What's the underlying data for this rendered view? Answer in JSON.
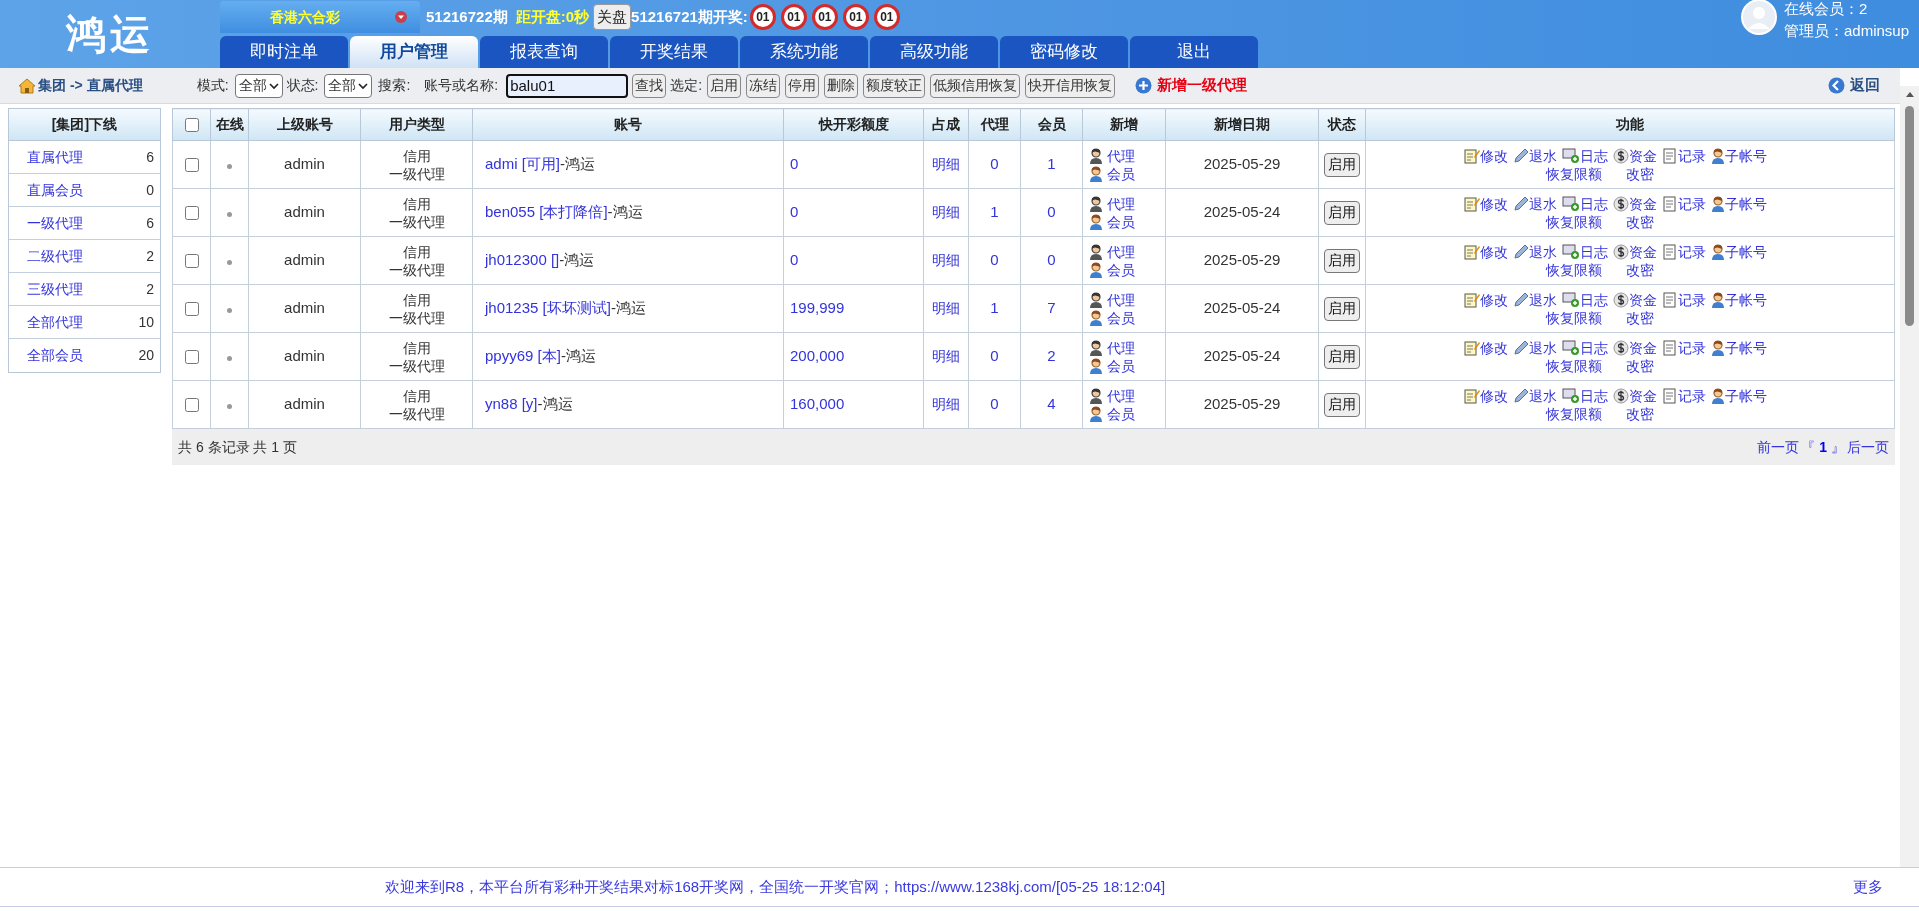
{
  "header": {
    "logo": "鸿运",
    "lottery": "香港六合彩",
    "current_issue": "51216722期",
    "countdown_label": "距开盘:",
    "countdown": "0秒",
    "close_button": "关盘",
    "last_issue": "51216721期开奖:",
    "balls": [
      "01",
      "01",
      "01",
      "01",
      "01"
    ],
    "online": "在线会员：2",
    "admin": "管理员：adminsup"
  },
  "tabs": [
    {
      "label": "即时注单",
      "selected": false
    },
    {
      "label": "用户管理",
      "selected": true
    },
    {
      "label": "报表查询",
      "selected": false
    },
    {
      "label": "开奖结果",
      "selected": false
    },
    {
      "label": "系统功能",
      "selected": false
    },
    {
      "label": "高级功能",
      "selected": false
    },
    {
      "label": "密码修改",
      "selected": false
    },
    {
      "label": "退出",
      "selected": false
    }
  ],
  "toolbar": {
    "breadcrumb": "集团 -> 直属代理",
    "mode_label": "模式:",
    "mode_value": "全部",
    "status_label": "状态:",
    "status_value": "全部",
    "search_label": "搜索:",
    "name_label": "账号或名称:",
    "search_value": "balu01",
    "search_button": "查找",
    "select_label": "选定:",
    "bulk_buttons": [
      "启用",
      "冻结",
      "停用",
      "删除",
      "额度较正",
      "低频信用恢复",
      "快开信用恢复"
    ],
    "add_link": "新增一级代理",
    "back_link": "返回"
  },
  "sidebar": {
    "title": "[集团]下线",
    "items": [
      {
        "label": "直属代理",
        "count": "6"
      },
      {
        "label": "直属会员",
        "count": "0"
      },
      {
        "label": "一级代理",
        "count": "6"
      },
      {
        "label": "二级代理",
        "count": "2"
      },
      {
        "label": "三级代理",
        "count": "2"
      },
      {
        "label": "全部代理",
        "count": "10"
      },
      {
        "label": "全部会员",
        "count": "20"
      }
    ]
  },
  "table": {
    "columns": [
      "在线",
      "上级账号",
      "用户类型",
      "账号",
      "快开彩额度",
      "占成",
      "代理",
      "会员",
      "新增",
      "新增日期",
      "状态",
      "功能"
    ],
    "header_checked": false,
    "rows": [
      {
        "checked": false,
        "online": false,
        "upline": "admin",
        "type": [
          "信用",
          "一级代理"
        ],
        "account": "admi [可用]",
        "suffix": "-鸿运",
        "credit": "0",
        "share": "明细",
        "agents": "0",
        "members": "1",
        "add": [
          "代理",
          "会员"
        ],
        "date": "2025-05-29",
        "status_button": "启用",
        "actions": [
          {
            "kind": "edit",
            "label": "修改"
          },
          {
            "kind": "rebate",
            "label": "退水"
          },
          {
            "kind": "log",
            "label": "日志"
          },
          {
            "kind": "money",
            "label": "资金"
          },
          {
            "kind": "record",
            "label": "记录"
          },
          {
            "kind": "sub",
            "label": "子帐号"
          }
        ],
        "extra_links": [
          "恢复限额",
          "改密"
        ]
      },
      {
        "checked": false,
        "online": false,
        "upline": "admin",
        "type": [
          "信用",
          "一级代理"
        ],
        "account": "ben055 [本打降倍]",
        "suffix": "-鸿运",
        "credit": "0",
        "share": "明细",
        "agents": "1",
        "members": "0",
        "add": [
          "代理",
          "会员"
        ],
        "date": "2025-05-24",
        "status_button": "启用",
        "actions": [
          {
            "kind": "edit",
            "label": "修改"
          },
          {
            "kind": "rebate",
            "label": "退水"
          },
          {
            "kind": "log",
            "label": "日志"
          },
          {
            "kind": "money",
            "label": "资金"
          },
          {
            "kind": "record",
            "label": "记录"
          },
          {
            "kind": "sub",
            "label": "子帐号"
          }
        ],
        "extra_links": [
          "恢复限额",
          "改密"
        ]
      },
      {
        "checked": false,
        "online": false,
        "upline": "admin",
        "type": [
          "信用",
          "一级代理"
        ],
        "account": "jh012300 []",
        "suffix": "-鸿运",
        "credit": "0",
        "share": "明细",
        "agents": "0",
        "members": "0",
        "add": [
          "代理",
          "会员"
        ],
        "date": "2025-05-29",
        "status_button": "启用",
        "actions": [
          {
            "kind": "edit",
            "label": "修改"
          },
          {
            "kind": "rebate",
            "label": "退水"
          },
          {
            "kind": "log",
            "label": "日志"
          },
          {
            "kind": "money",
            "label": "资金"
          },
          {
            "kind": "record",
            "label": "记录"
          },
          {
            "kind": "sub",
            "label": "子帐号"
          }
        ],
        "extra_links": [
          "恢复限额",
          "改密"
        ]
      },
      {
        "checked": false,
        "online": false,
        "upline": "admin",
        "type": [
          "信用",
          "一级代理"
        ],
        "account": "jh01235 [坏坏测试]",
        "suffix": "-鸿运",
        "credit": "199,999",
        "share": "明细",
        "agents": "1",
        "members": "7",
        "add": [
          "代理",
          "会员"
        ],
        "date": "2025-05-24",
        "status_button": "启用",
        "actions": [
          {
            "kind": "edit",
            "label": "修改"
          },
          {
            "kind": "rebate",
            "label": "退水"
          },
          {
            "kind": "log",
            "label": "日志"
          },
          {
            "kind": "money",
            "label": "资金"
          },
          {
            "kind": "record",
            "label": "记录"
          },
          {
            "kind": "sub",
            "label": "子帐号"
          }
        ],
        "extra_links": [
          "恢复限额",
          "改密"
        ]
      },
      {
        "checked": false,
        "online": false,
        "upline": "admin",
        "type": [
          "信用",
          "一级代理"
        ],
        "account": "ppyy69 [本]",
        "suffix": "-鸿运",
        "credit": "200,000",
        "share": "明细",
        "agents": "0",
        "members": "2",
        "add": [
          "代理",
          "会员"
        ],
        "date": "2025-05-24",
        "status_button": "启用",
        "actions": [
          {
            "kind": "edit",
            "label": "修改"
          },
          {
            "kind": "rebate",
            "label": "退水"
          },
          {
            "kind": "log",
            "label": "日志"
          },
          {
            "kind": "money",
            "label": "资金"
          },
          {
            "kind": "record",
            "label": "记录"
          },
          {
            "kind": "sub",
            "label": "子帐号"
          }
        ],
        "extra_links": [
          "恢复限额",
          "改密"
        ]
      },
      {
        "checked": false,
        "online": false,
        "upline": "admin",
        "type": [
          "信用",
          "一级代理"
        ],
        "account": "yn88 [y]",
        "suffix": "-鸿运",
        "credit": "160,000",
        "share": "明细",
        "agents": "0",
        "members": "4",
        "add": [
          "代理",
          "会员"
        ],
        "date": "2025-05-29",
        "status_button": "启用",
        "actions": [
          {
            "kind": "edit",
            "label": "修改"
          },
          {
            "kind": "rebate",
            "label": "退水"
          },
          {
            "kind": "log",
            "label": "日志"
          },
          {
            "kind": "money",
            "label": "资金"
          },
          {
            "kind": "record",
            "label": "记录"
          },
          {
            "kind": "sub",
            "label": "子帐号"
          }
        ],
        "extra_links": [
          "恢复限额",
          "改密"
        ]
      }
    ]
  },
  "pager": {
    "summary": "共 6 条记录 共 1 页",
    "prev": "前一页",
    "open": "『",
    "page": "1",
    "close": "』",
    "next": "后一页"
  },
  "status_bar": {
    "message": "欢迎来到R8，本平台所有彩种开奖结果对标168开奖网，全国统一开奖官网；https://www.1238kj.com/[05-25 18:12:04]",
    "more": "更多"
  }
}
